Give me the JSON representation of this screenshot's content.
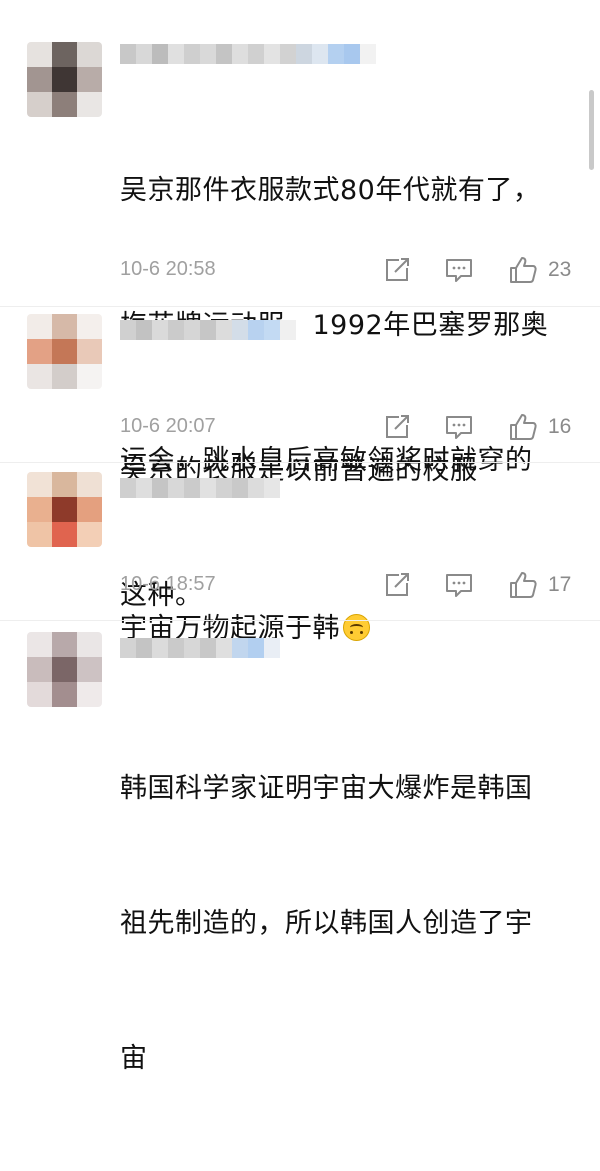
{
  "comments": [
    {
      "text_lines": [
        "吴京那件衣服款式80年代就有了，",
        "梅花牌运动服。1992年巴塞罗那奥",
        "运会，跳水皇后高敏领奖时就穿的",
        "这种。"
      ],
      "time": "10-6 20:58",
      "likes": "23",
      "has_emoji": false
    },
    {
      "text_lines": [
        "吴京的衣服是以前普遍的校服"
      ],
      "time": "10-6 20:07",
      "likes": "16",
      "has_emoji": false
    },
    {
      "text_lines": [
        "宇宙万物起源于韩"
      ],
      "time": "10-6 18:57",
      "likes": "17",
      "has_emoji": true,
      "emoji": "upside-down-face"
    },
    {
      "text_lines": [
        "韩国科学家证明宇宙大爆炸是韩国",
        "祖先制造的，所以韩国人创造了宇",
        "宙"
      ],
      "time": "",
      "likes": "",
      "has_emoji": false
    }
  ],
  "icons": {
    "share": "share-icon",
    "comment": "comment-icon",
    "like": "thumbs-up-icon"
  },
  "colors": {
    "text": "#111111",
    "meta": "#a0a0a0",
    "icon": "#8a8a8a",
    "divider": "#eeeeee",
    "name_blur_accent": "#a8c8ee"
  }
}
